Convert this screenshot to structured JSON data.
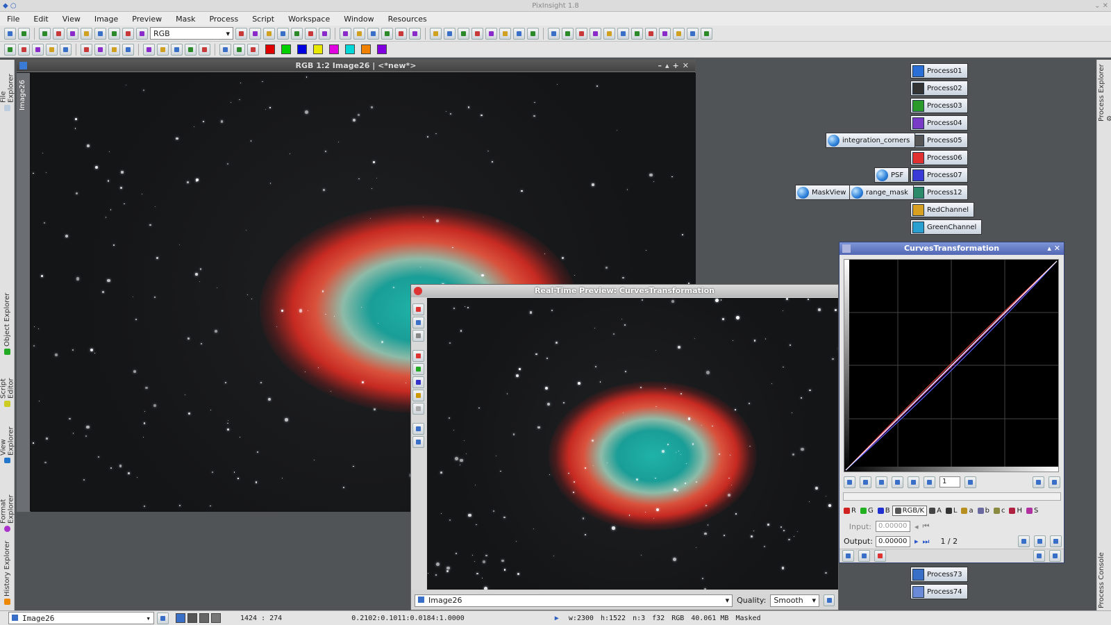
{
  "app": {
    "title": "PixInsight 1.8"
  },
  "menu": [
    "File",
    "Edit",
    "View",
    "Image",
    "Preview",
    "Mask",
    "Process",
    "Script",
    "Workspace",
    "Window",
    "Resources"
  ],
  "toolbar": {
    "channel_combo": "RGB",
    "swatches": [
      "#e00000",
      "#00d000",
      "#0000e0",
      "#e8e800",
      "#e000e0",
      "#00d8d8",
      "#f08000",
      "#8000e0"
    ]
  },
  "left_tabs": [
    "File Explorer",
    "Object Explorer",
    "Script Editor",
    "View Explorer",
    "Format Explorer",
    "History Explorer"
  ],
  "right_tabs": [
    "Process Explorer",
    "Process Console"
  ],
  "image_window": {
    "title": "RGB 1:2 Image26 | <*new*>",
    "side_tab": "Image26"
  },
  "process_icons": [
    "Process01",
    "Process02",
    "Process03",
    "Process04",
    "Process05",
    "Process06",
    "Process07",
    "Process12",
    "RedChannel",
    "GreenChannel",
    "Process73",
    "Process74"
  ],
  "other_icons": [
    "integration_corners",
    "PSF",
    "MaskView",
    "range_mask"
  ],
  "curves": {
    "title": "CurvesTransformation",
    "zoom": "1",
    "channels": [
      "R",
      "G",
      "B",
      "RGB/K",
      "A",
      "L",
      "a",
      "b",
      "c",
      "H",
      "S"
    ],
    "active_channel": "RGB/K",
    "input_label": "Input:",
    "input_value": "0.00000",
    "output_label": "Output:",
    "output_value": "0.00000",
    "point_index": "1 / 2"
  },
  "preview": {
    "title": "Real-Time Preview: CurvesTransformation",
    "view": "Image26",
    "quality_label": "Quality:",
    "quality": "Smooth"
  },
  "status": {
    "view": "Image26",
    "coords": "1424 : 274",
    "values": "0.2102:0.1011:0.0184:1.0000",
    "width": "w:2300",
    "height": "h:1522",
    "channels": "n:3",
    "format": "f32",
    "color_space": "RGB",
    "size": "40.061 MB",
    "mask": "Masked"
  }
}
